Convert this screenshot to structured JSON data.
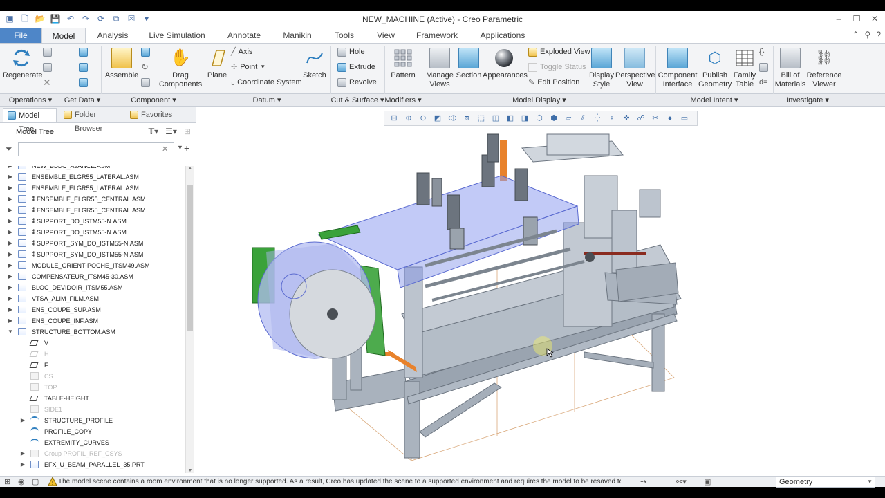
{
  "window": {
    "title": "NEW_MACHINE (Active) - Creo Parametric",
    "controls": [
      "–",
      "❐",
      "✕"
    ]
  },
  "tabs": [
    {
      "label": "File"
    },
    {
      "label": "Model"
    },
    {
      "label": "Analysis"
    },
    {
      "label": "Live Simulation"
    },
    {
      "label": "Annotate"
    },
    {
      "label": "Manikin"
    },
    {
      "label": "Tools"
    },
    {
      "label": "View"
    },
    {
      "label": "Framework"
    },
    {
      "label": "Applications"
    }
  ],
  "ribbon": {
    "regenerate": "Regenerate",
    "assemble": "Assemble",
    "drag_components": "Drag\nComponents",
    "plane": "Plane",
    "axis": "Axis",
    "point": "Point",
    "coordinate_system": "Coordinate System",
    "sketch": "Sketch",
    "hole": "Hole",
    "extrude": "Extrude",
    "revolve": "Revolve",
    "pattern": "Pattern",
    "manage_views": "Manage\nViews",
    "section": "Section",
    "appearances": "Appearances",
    "exploded_view": "Exploded View",
    "toggle_status": "Toggle Status",
    "edit_position": "Edit Position",
    "display_style": "Display\nStyle",
    "perspective_view": "Perspective\nView",
    "component_interface": "Component\nInterface",
    "publish_geometry": "Publish\nGeometry",
    "family_table": "Family\nTable",
    "bill_of_materials": "Bill of\nMaterials",
    "reference_viewer": "Reference\nViewer"
  },
  "groups": {
    "operations": "Operations",
    "get_data": "Get Data",
    "component": "Component",
    "datum": "Datum",
    "cut_surface": "Cut & Surface",
    "modifiers": "Modifiers",
    "model_display": "Model Display",
    "model_intent": "Model Intent",
    "investigate": "Investigate"
  },
  "panel": {
    "tabs": [
      "Model Tree",
      "Folder Browser",
      "Favorites"
    ],
    "tree_title": "Model Tree",
    "filter_value": ""
  },
  "tree": [
    {
      "label": "NEW_BLOC_AVANCE.ASM",
      "depth": 0,
      "exp": "▶",
      "icon": "asm",
      "dim": false
    },
    {
      "label": "ENSEMBLE_ELGR55_LATERAL.ASM",
      "depth": 0,
      "exp": "▶",
      "icon": "asm",
      "dim": false
    },
    {
      "label": "ENSEMBLE_ELGR55_LATERAL.ASM",
      "depth": 0,
      "exp": "▶",
      "icon": "asm",
      "dim": false
    },
    {
      "label": "ENSEMBLE_ELGR55_CENTRAL.ASM",
      "depth": 0,
      "exp": "▶",
      "icon": "asm",
      "dim": false,
      "flex": true
    },
    {
      "label": "ENSEMBLE_ELGR55_CENTRAL.ASM",
      "depth": 0,
      "exp": "▶",
      "icon": "asm",
      "dim": false,
      "flex": true
    },
    {
      "label": "SUPPORT_DO_ISTM55-N.ASM",
      "depth": 0,
      "exp": "▶",
      "icon": "asm",
      "dim": false,
      "flex": true
    },
    {
      "label": "SUPPORT_DO_ISTM55-N.ASM",
      "depth": 0,
      "exp": "▶",
      "icon": "asm",
      "dim": false,
      "flex": true
    },
    {
      "label": "SUPPORT_SYM_DO_ISTM55-N.ASM",
      "depth": 0,
      "exp": "▶",
      "icon": "asm",
      "dim": false,
      "flex": true
    },
    {
      "label": "SUPPORT_SYM_DO_ISTM55-N.ASM",
      "depth": 0,
      "exp": "▶",
      "icon": "asm",
      "dim": false,
      "flex": true
    },
    {
      "label": "MODULE_ORIENT-POCHE_ITSM49.ASM",
      "depth": 0,
      "exp": "▶",
      "icon": "asm",
      "dim": false
    },
    {
      "label": "COMPENSATEUR_ITSM45-30.ASM",
      "depth": 0,
      "exp": "▶",
      "icon": "asm",
      "dim": false
    },
    {
      "label": "BLOC_DEVIDOIR_ITSM55.ASM",
      "depth": 0,
      "exp": "▶",
      "icon": "asm",
      "dim": false
    },
    {
      "label": "VTSA_ALIM_FILM.ASM",
      "depth": 0,
      "exp": "▶",
      "icon": "asm",
      "dim": false
    },
    {
      "label": "ENS_COUPE_SUP.ASM",
      "depth": 0,
      "exp": "▶",
      "icon": "asm",
      "dim": false
    },
    {
      "label": "ENS_COUPE_INF.ASM",
      "depth": 0,
      "exp": "▶",
      "icon": "asm",
      "dim": false
    },
    {
      "label": "STRUCTURE_BOTTOM.ASM",
      "depth": 0,
      "exp": "▼",
      "icon": "asm",
      "dim": false
    },
    {
      "label": "V",
      "depth": 1,
      "exp": "",
      "icon": "plane",
      "dim": false
    },
    {
      "label": "H",
      "depth": 1,
      "exp": "",
      "icon": "plane",
      "dim": true
    },
    {
      "label": "F",
      "depth": 1,
      "exp": "",
      "icon": "plane",
      "dim": false
    },
    {
      "label": "CS",
      "depth": 1,
      "exp": "",
      "icon": "csys",
      "dim": true
    },
    {
      "label": "TOP",
      "depth": 1,
      "exp": "",
      "icon": "csys",
      "dim": true
    },
    {
      "label": "TABLE-HEIGHT",
      "depth": 1,
      "exp": "",
      "icon": "plane",
      "dim": false
    },
    {
      "label": "SIDE1",
      "depth": 1,
      "exp": "",
      "icon": "csys",
      "dim": true
    },
    {
      "label": "STRUCTURE_PROFILE",
      "depth": 1,
      "exp": "▶",
      "icon": "curve",
      "dim": false
    },
    {
      "label": "PROFILE_COPY",
      "depth": 1,
      "exp": "",
      "icon": "curve",
      "dim": false
    },
    {
      "label": "EXTREMITY_CURVES",
      "depth": 1,
      "exp": "",
      "icon": "curve",
      "dim": false
    },
    {
      "label": "Group PROFIL_REF_CSYS",
      "depth": 1,
      "exp": "▶",
      "icon": "csys",
      "dim": true
    },
    {
      "label": "EFX_U_BEAM_PARALLEL_35.PRT",
      "depth": 1,
      "exp": "▶",
      "icon": "asm",
      "dim": false
    }
  ],
  "status": {
    "message": "The model scene contains a room environment that is no longer supported.  As a result, Creo has updated the scene to a supported environment and requires the model to be resaved to avoid this message ir",
    "selection_filter": "Geometry"
  },
  "colors": {
    "file_tab": "#4e86c8",
    "ribbon_bg": "#f3f4f6",
    "frame_gray": "#b9c2cc",
    "film_blue": "#8f9ff0",
    "green_part": "#3aa23a",
    "orange_part": "#e8822c"
  }
}
